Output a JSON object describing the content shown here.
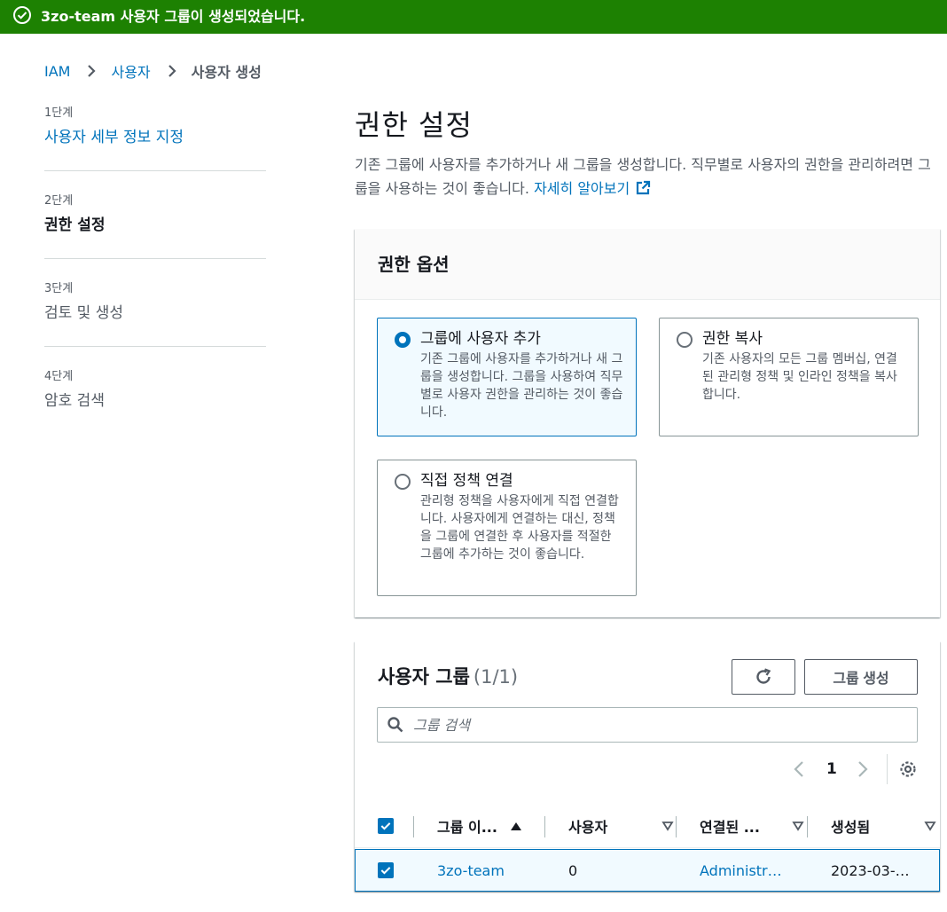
{
  "flash": {
    "message": "3zo-team 사용자 그룹이 생성되었습니다.",
    "color": "#1d8102"
  },
  "breadcrumb": {
    "items": [
      "IAM",
      "사용자"
    ],
    "current": "사용자 생성"
  },
  "steps": [
    {
      "number": "1단계",
      "title": "사용자 세부 정보 지정"
    },
    {
      "number": "2단계",
      "title": "권한 설정"
    },
    {
      "number": "3단계",
      "title": "검토 및 생성"
    },
    {
      "number": "4단계",
      "title": "암호 검색"
    }
  ],
  "page": {
    "title": "권한 설정",
    "description": "기존 그룹에 사용자를 추가하거나 새 그룹을 생성합니다. 직무별로 사용자의 권한을 관리하려면 그룹을 사용하는 것이 좋습니다.",
    "learn_more": "자세히 알아보기"
  },
  "options": {
    "heading": "권한 옵션",
    "tiles": [
      {
        "title": "그룹에 사용자 추가",
        "description": "기존 그룹에 사용자를 추가하거나 새 그룹을 생성합니다. 그룹을 사용하여 직무별로 사용자 권한을 관리하는 것이 좋습니다.",
        "selected": true
      },
      {
        "title": "권한 복사",
        "description": "기존 사용자의 모든 그룹 멤버십, 연결된 관리형 정책 및 인라인 정책을 복사합니다.",
        "selected": false
      },
      {
        "title": "직접 정책 연결",
        "description": "관리형 정책을 사용자에게 직접 연결합니다. 사용자에게 연결하는 대신, 정책을 그룹에 연결한 후 사용자를 적절한 그룹에 추가하는 것이 좋습니다.",
        "selected": false
      }
    ]
  },
  "groups": {
    "heading": "사용자 그룹",
    "count": "(1/1)",
    "create_label": "그룹 생성",
    "search_placeholder": "그룹 검색",
    "page_number": "1",
    "columns": [
      "그룹 이...",
      "사용자",
      "연결된 ...",
      "생성됨"
    ],
    "rows": [
      {
        "name": "3zo-team",
        "users": "0",
        "policies": "Administr…",
        "created": "2023-03-…",
        "selected": true
      }
    ]
  },
  "colors": {
    "accent": "#0073bb",
    "success": "#1d8102"
  }
}
